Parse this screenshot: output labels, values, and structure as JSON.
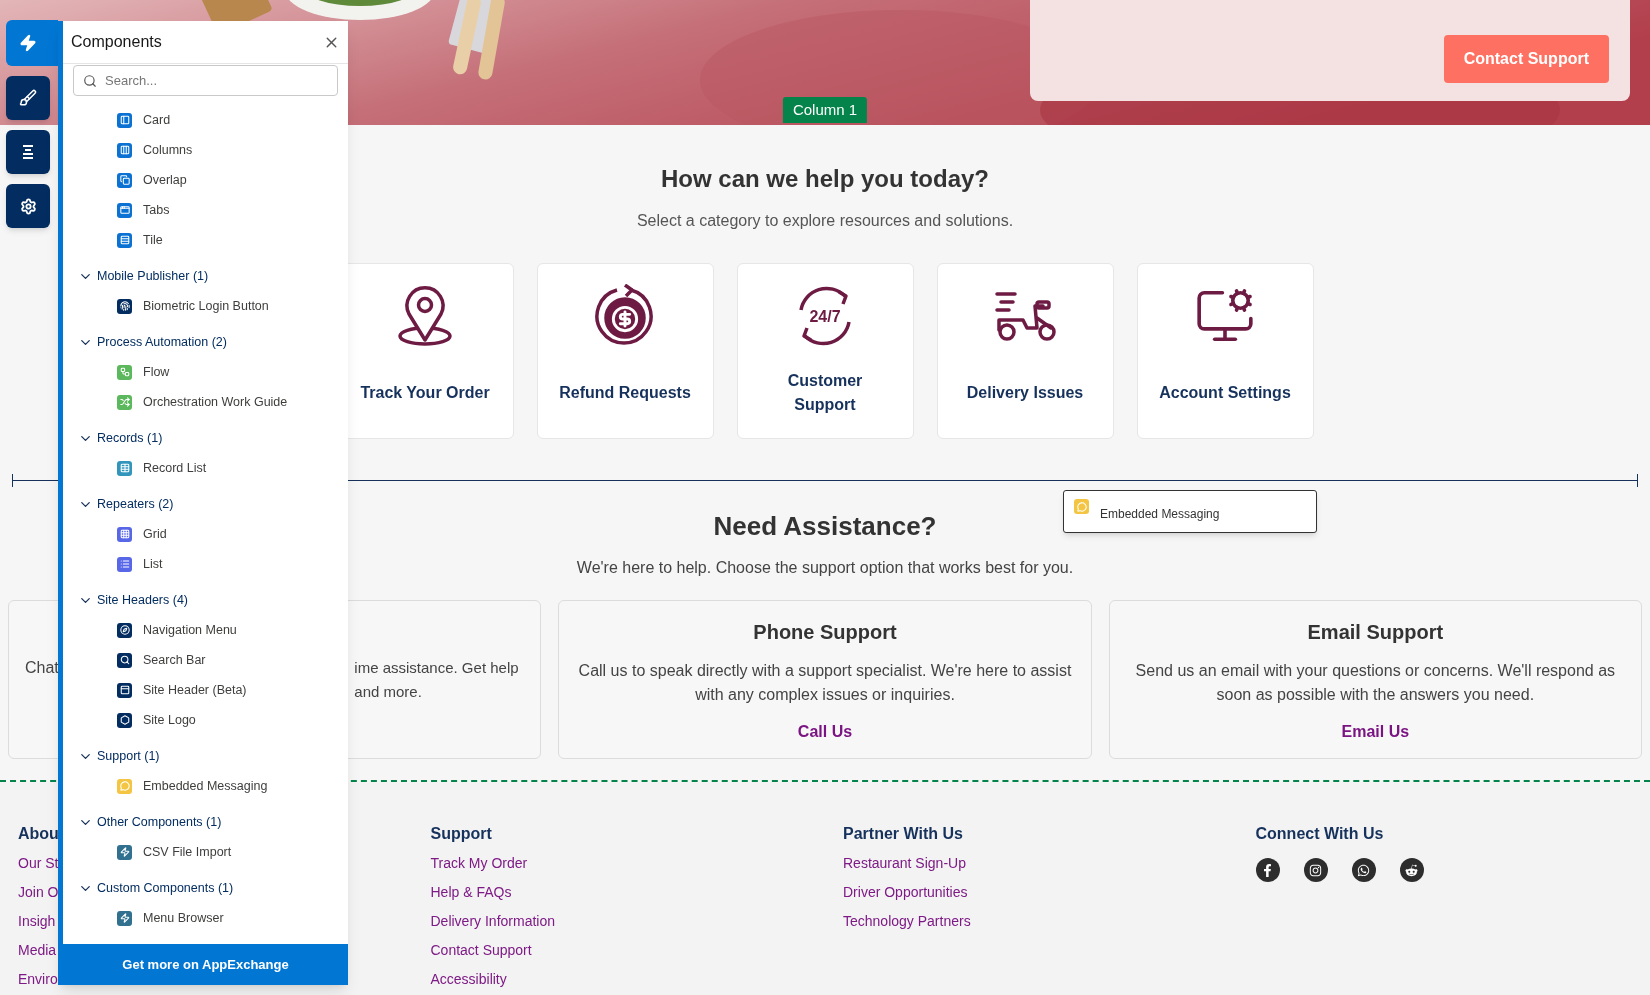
{
  "hero": {
    "button": "Contact Support",
    "column_tag": "Column 1"
  },
  "help": {
    "title": "How can we help you today?",
    "subtitle": "Select a category to explore resources and solutions.",
    "categories": [
      {
        "label": "Track Your Order",
        "kind": "pin"
      },
      {
        "label": "Refund Requests",
        "kind": "refund"
      },
      {
        "label": "Customer Support",
        "kind": "clock",
        "icon_text": "24/7"
      },
      {
        "label": "Delivery Issues",
        "kind": "scooter"
      },
      {
        "label": "Account Settings",
        "kind": "monitor"
      }
    ]
  },
  "drag_preview": {
    "label": "Embedded Messaging"
  },
  "assistance": {
    "title": "Need Assistance?",
    "subtitle": "We're here to help. Choose the support option that works best for you.",
    "options": [
      {
        "kind": "covered",
        "fragments": [
          "Chat",
          "ime assistance. Get help and more."
        ]
      },
      {
        "kind": "full",
        "title": "Phone Support",
        "text": "Call us to speak directly with a support specialist. We're here to assist with any complex issues or inquiries.",
        "link": "Call Us"
      },
      {
        "kind": "full",
        "title": "Email Support",
        "text": "Send us an email with your questions or concerns. We'll respond as soon as possible with the answers you need.",
        "link": "Email Us"
      }
    ]
  },
  "footer": {
    "columns": [
      {
        "heading": "Abou",
        "links": [
          "Our St",
          "Join O",
          "Insigh",
          "Media",
          "Enviro"
        ]
      },
      {
        "heading": "Support",
        "links": [
          "Track My Order",
          "Help & FAQs",
          "Delivery Information",
          "Contact Support",
          "Accessibility"
        ]
      },
      {
        "heading": "Partner With Us",
        "links": [
          "Restaurant Sign-Up",
          "Driver Opportunities",
          "Technology Partners"
        ]
      },
      {
        "heading": "Connect With Us",
        "social": [
          {
            "kind": "facebook"
          },
          {
            "kind": "instagram"
          },
          {
            "kind": "whatsapp"
          },
          {
            "kind": "reddit"
          }
        ]
      }
    ]
  },
  "toolbar": [
    {
      "kind": "components",
      "selected": true
    },
    {
      "kind": "theme",
      "selected": false
    },
    {
      "kind": "structure",
      "selected": false
    },
    {
      "kind": "settings",
      "selected": false
    }
  ],
  "panel": {
    "title": "Components",
    "search": {
      "placeholder": "Search..."
    },
    "groups": [
      {
        "items": [
          {
            "label": "Card",
            "kind": "card"
          },
          {
            "label": "Columns",
            "kind": "columns"
          },
          {
            "label": "Overlap",
            "kind": "overlap"
          },
          {
            "label": "Tabs",
            "kind": "tabs"
          },
          {
            "label": "Tile",
            "kind": "tile"
          }
        ]
      },
      {
        "label": "Mobile Publisher (1)",
        "expanded": true,
        "items": [
          {
            "label": "Biometric Login Button",
            "kind": "biometric"
          }
        ]
      },
      {
        "label": "Process Automation (2)",
        "expanded": true,
        "items": [
          {
            "label": "Flow",
            "kind": "flow"
          },
          {
            "label": "Orchestration Work Guide",
            "kind": "orchestration"
          }
        ]
      },
      {
        "label": "Records (1)",
        "expanded": true,
        "items": [
          {
            "label": "Record List",
            "kind": "record-list"
          }
        ]
      },
      {
        "label": "Repeaters (2)",
        "expanded": true,
        "items": [
          {
            "label": "Grid",
            "kind": "grid"
          },
          {
            "label": "List",
            "kind": "list"
          }
        ]
      },
      {
        "label": "Site Headers (4)",
        "expanded": true,
        "items": [
          {
            "label": "Navigation Menu",
            "kind": "navigation"
          },
          {
            "label": "Search Bar",
            "kind": "search"
          },
          {
            "label": "Site Header (Beta)",
            "kind": "site-header"
          },
          {
            "label": "Site Logo",
            "kind": "logo"
          }
        ]
      },
      {
        "label": "Support (1)",
        "expanded": true,
        "items": [
          {
            "label": "Embedded Messaging",
            "kind": "messaging"
          }
        ]
      },
      {
        "label": "Other Components (1)",
        "expanded": true,
        "items": [
          {
            "label": "CSV File Import",
            "kind": "lightning"
          }
        ]
      },
      {
        "label": "Custom Components (1)",
        "expanded": true,
        "items": [
          {
            "label": "Menu Browser",
            "kind": "lightning"
          }
        ]
      }
    ],
    "footer_button": "Get more on AppExchange"
  }
}
